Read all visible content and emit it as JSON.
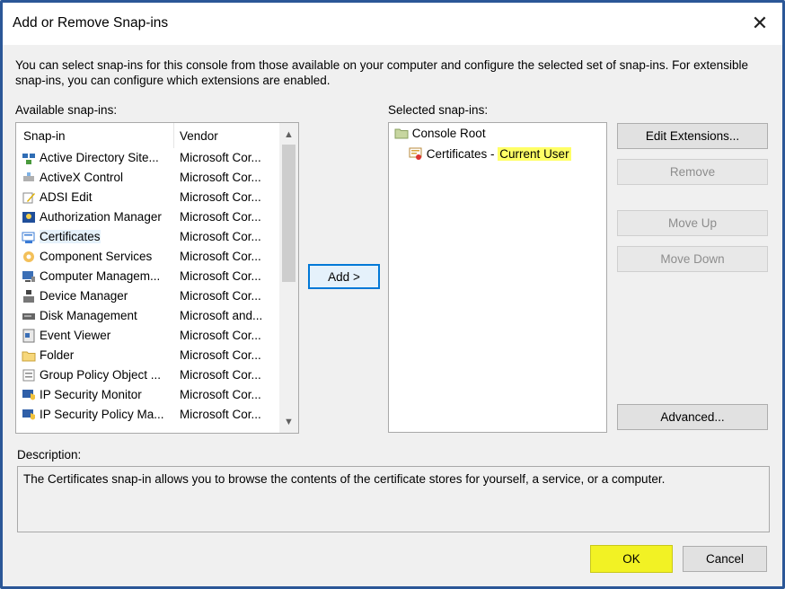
{
  "window": {
    "title": "Add or Remove Snap-ins",
    "close_glyph": "✕"
  },
  "intro_text": "You can select snap-ins for this console from those available on your computer and configure the selected set of snap-ins. For extensible snap-ins, you can configure which extensions are enabled.",
  "available": {
    "label": "Available snap-ins:",
    "columns": {
      "snapin": "Snap-in",
      "vendor": "Vendor"
    },
    "items": [
      {
        "name": "Active Directory Site...",
        "vendor": "Microsoft Cor...",
        "icon": "ad-sites-icon"
      },
      {
        "name": "ActiveX Control",
        "vendor": "Microsoft Cor...",
        "icon": "activex-icon"
      },
      {
        "name": "ADSI Edit",
        "vendor": "Microsoft Cor...",
        "icon": "adsi-edit-icon"
      },
      {
        "name": "Authorization Manager",
        "vendor": "Microsoft Cor...",
        "icon": "authorization-icon"
      },
      {
        "name": "Certificates",
        "vendor": "Microsoft Cor...",
        "icon": "certificates-icon"
      },
      {
        "name": "Component Services",
        "vendor": "Microsoft Cor...",
        "icon": "component-services-icon"
      },
      {
        "name": "Computer Managem...",
        "vendor": "Microsoft Cor...",
        "icon": "computer-management-icon"
      },
      {
        "name": "Device Manager",
        "vendor": "Microsoft Cor...",
        "icon": "device-manager-icon"
      },
      {
        "name": "Disk Management",
        "vendor": "Microsoft and...",
        "icon": "disk-management-icon"
      },
      {
        "name": "Event Viewer",
        "vendor": "Microsoft Cor...",
        "icon": "event-viewer-icon"
      },
      {
        "name": "Folder",
        "vendor": "Microsoft Cor...",
        "icon": "folder-icon"
      },
      {
        "name": "Group Policy Object ...",
        "vendor": "Microsoft Cor...",
        "icon": "group-policy-icon"
      },
      {
        "name": "IP Security Monitor",
        "vendor": "Microsoft Cor...",
        "icon": "ip-security-monitor-icon"
      },
      {
        "name": "IP Security Policy Ma...",
        "vendor": "Microsoft Cor...",
        "icon": "ip-security-policy-icon"
      }
    ],
    "selected_item": "Certificates"
  },
  "add_button": "Add >",
  "selected": {
    "label": "Selected snap-ins:",
    "root": "Console Root",
    "child_prefix": "Certificates - ",
    "child_highlight": "Current User"
  },
  "buttons": {
    "edit_extensions": "Edit Extensions...",
    "remove": "Remove",
    "move_up": "Move Up",
    "move_down": "Move Down",
    "advanced": "Advanced...",
    "ok": "OK",
    "cancel": "Cancel"
  },
  "description": {
    "label": "Description:",
    "text": "The Certificates snap-in allows you to browse the contents of the certificate stores for yourself, a service, or a computer."
  },
  "colors": {
    "frame_border": "#2b5797",
    "highlight_yellow": "#ffff66",
    "ok_highlight": "#f2f224",
    "focus_blue": "#0078d7"
  }
}
